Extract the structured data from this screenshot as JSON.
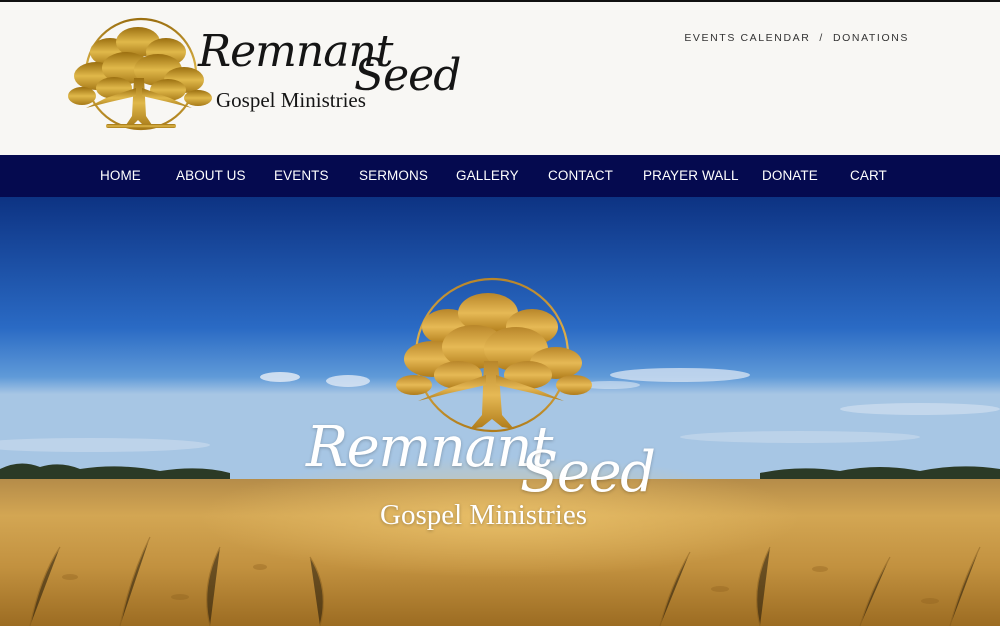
{
  "header": {
    "logo": {
      "word1": "Remnant",
      "word2": "Seed",
      "subtitle": "Gospel Ministries"
    },
    "top_links": [
      "EVENTS CALENDAR",
      "DONATIONS"
    ],
    "top_links_separator": "/"
  },
  "nav": {
    "items": [
      {
        "label": "HOME"
      },
      {
        "label": "ABOUT US"
      },
      {
        "label": "EVENTS"
      },
      {
        "label": "SERMONS"
      },
      {
        "label": "GALLERY"
      },
      {
        "label": "CONTACT"
      },
      {
        "label": "PRAYER WALL"
      },
      {
        "label": "DONATE"
      },
      {
        "label": "CART"
      }
    ]
  },
  "hero": {
    "logo": {
      "word1": "Remnant",
      "word2": "Seed",
      "subtitle": "Gospel Ministries"
    },
    "icon": "gold-oak-tree-icon"
  },
  "colors": {
    "nav_background": "#050a4f",
    "header_background": "#f8f7f4",
    "logo_gold": "#c89a2a",
    "sky_top": "#123c8a",
    "wheat": "#c59a45"
  }
}
